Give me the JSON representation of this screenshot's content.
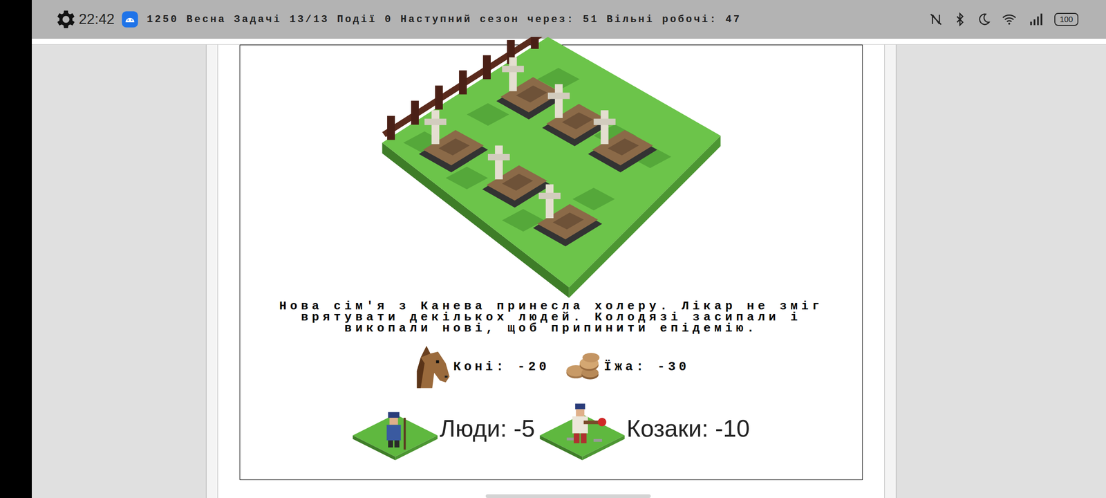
{
  "status_bar": {
    "time": "22:42",
    "battery": "100"
  },
  "game_status": {
    "text": "1250 Весна Задачі 13/13 Події 0 Наступний сезон через: 51 Вільні робочі: 47"
  },
  "event": {
    "lines": [
      "Нова сім'я з Канева принесла холеру. Лікар не зміг",
      "врятувати декількох людей. Колодязі засипали і",
      "викопали нові, щоб припинити епідемію."
    ]
  },
  "resources": [
    {
      "label": "Коні: -20",
      "kind": "horse"
    },
    {
      "label": "Їжа: -30",
      "kind": "food"
    }
  ],
  "population": [
    {
      "label": "Люди: -5",
      "kind": "peasant"
    },
    {
      "label": "Козаки: -10",
      "kind": "cossack"
    }
  ]
}
